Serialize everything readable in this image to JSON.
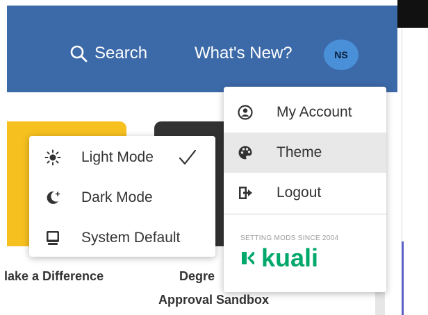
{
  "header": {
    "search_label": "Search",
    "whats_new_label": "What's New?",
    "avatar_initials": "NS",
    "background_color": "#3c69a8"
  },
  "cards": [
    {
      "title": "lake a Difference",
      "color": "#f6c01f"
    },
    {
      "title_line1": "Degre",
      "title_line2": "Approval Sandbox",
      "color": "#333333"
    }
  ],
  "account_menu": {
    "items": [
      {
        "label": "My Account",
        "icon": "user-circle-icon"
      },
      {
        "label": "Theme",
        "icon": "palette-icon",
        "active": true
      },
      {
        "label": "Logout",
        "icon": "logout-icon"
      }
    ],
    "tagline": "SETTING MODS SINCE 2004",
    "logo_text": "kuali",
    "logo_color": "#00a86b"
  },
  "theme_menu": {
    "items": [
      {
        "label": "Light Mode",
        "icon": "sun-icon",
        "selected": true
      },
      {
        "label": "Dark Mode",
        "icon": "moon-icon",
        "selected": false
      },
      {
        "label": "System Default",
        "icon": "monitor-icon",
        "selected": false
      }
    ]
  }
}
